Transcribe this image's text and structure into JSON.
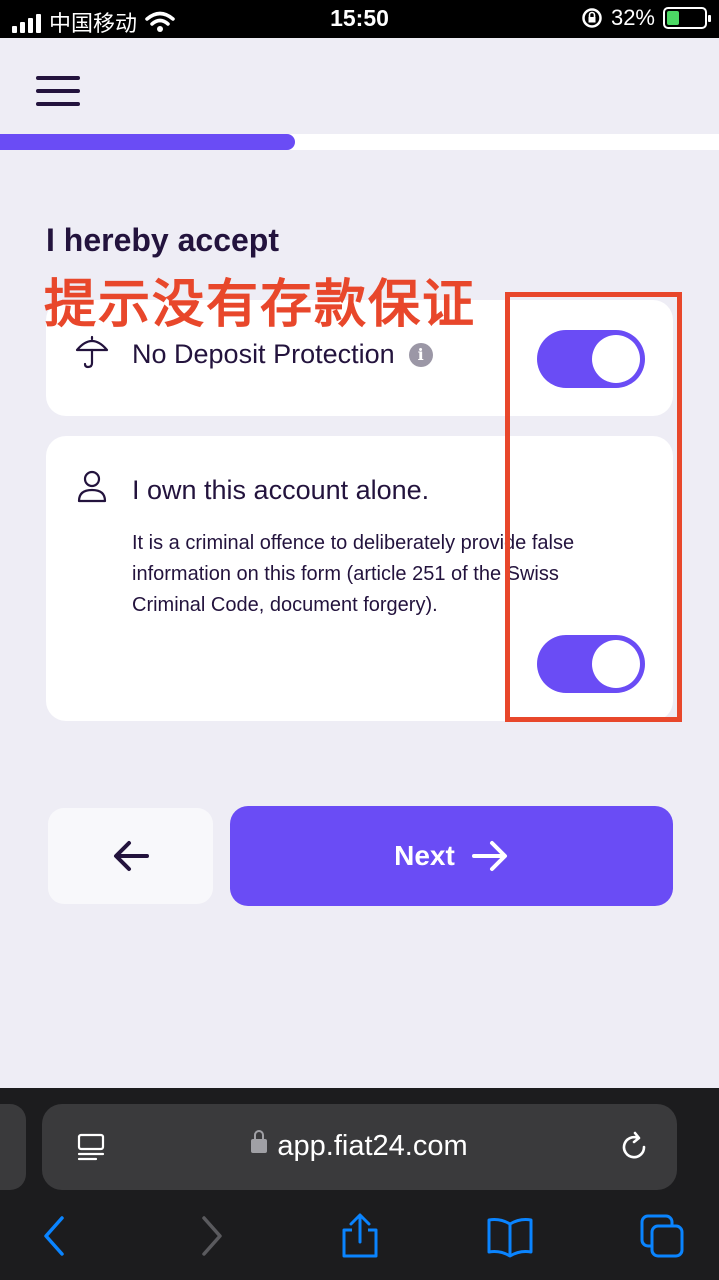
{
  "status_bar": {
    "carrier": "中国移动",
    "time": "15:50",
    "battery": "32%",
    "battery_level": 0.32
  },
  "progress": {
    "fraction": 0.41
  },
  "page": {
    "heading": "I hereby accept",
    "annotation": "提示没有存款保证"
  },
  "cards": {
    "deposit": {
      "title": "No Deposit Protection",
      "toggle_on": true,
      "icon": "umbrella-icon"
    },
    "ownership": {
      "title": "I own this account alone.",
      "description": "It is a criminal offence to deliberately provide false information on this form (article 251 of the Swiss Criminal Code, document forgery).",
      "toggle_on": true,
      "icon": "user-icon"
    }
  },
  "buttons": {
    "next_label": "Next"
  },
  "browser": {
    "url": "app.fiat24.com"
  },
  "colors": {
    "accent": "#6a4cf5",
    "annotation": "#e8472b",
    "text": "#23133d",
    "background": "#eeedf5",
    "safari_blue": "#0a84ff"
  }
}
